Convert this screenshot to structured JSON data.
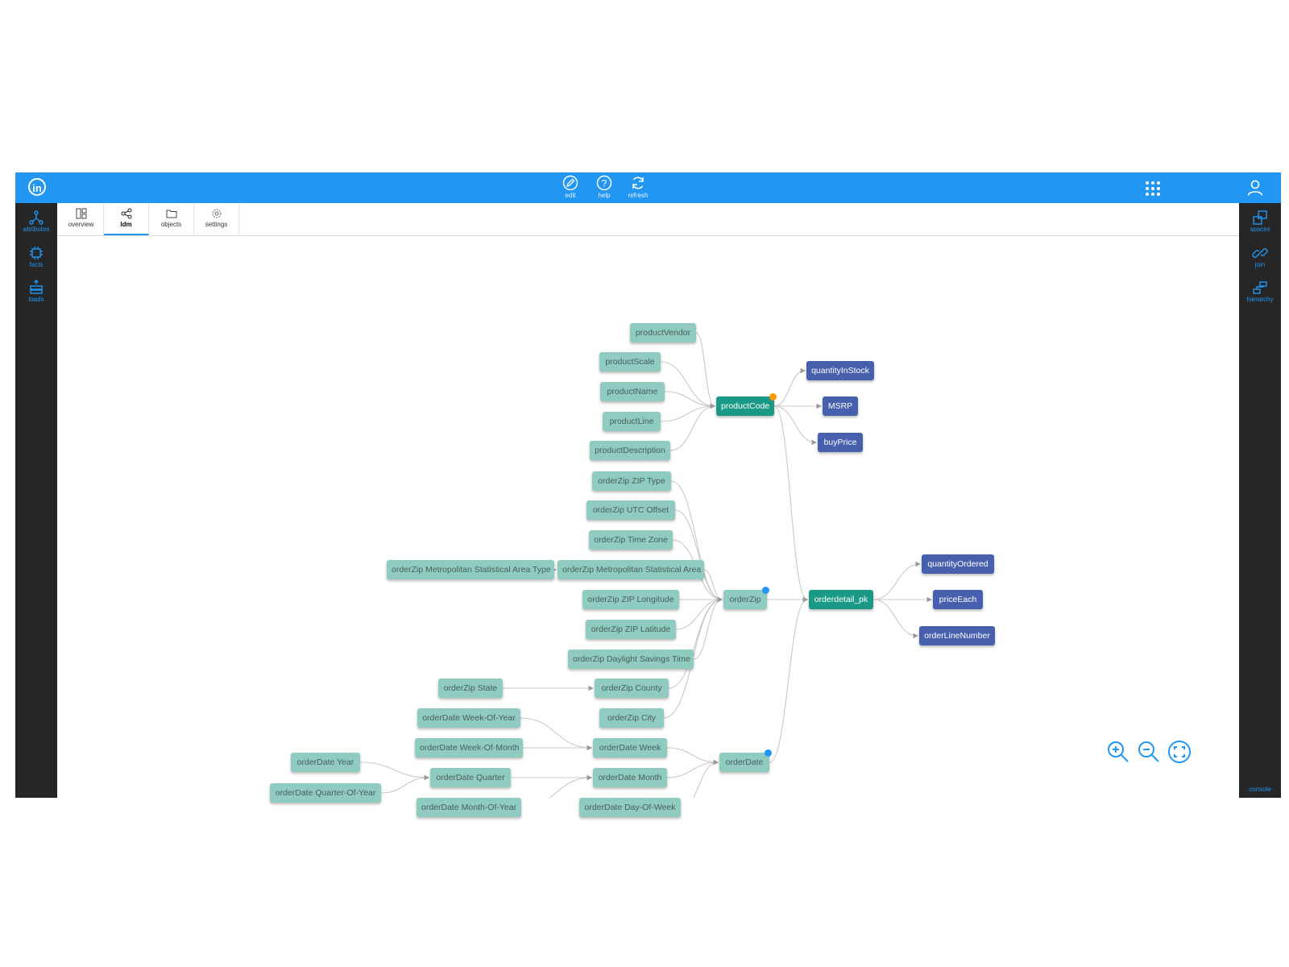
{
  "header": {
    "logo_text": "in",
    "tools": [
      {
        "label": "edit",
        "icon": "edit-icon"
      },
      {
        "label": "help",
        "icon": "help-icon"
      },
      {
        "label": "refresh",
        "icon": "refresh-icon"
      }
    ],
    "apps_icon": "apps-grid-icon",
    "user_icon": "user-icon"
  },
  "left_sidebar": {
    "items": [
      {
        "label": "attributes",
        "icon": "attributes-icon"
      },
      {
        "label": "facts",
        "icon": "facts-icon"
      },
      {
        "label": "loads",
        "icon": "loads-icon"
      }
    ]
  },
  "right_sidebar": {
    "items": [
      {
        "label": "spaces",
        "icon": "spaces-icon"
      },
      {
        "label": "join",
        "icon": "join-icon"
      },
      {
        "label": "hierarchy",
        "icon": "hierarchy-icon"
      }
    ],
    "console_label": "console"
  },
  "tabs": [
    {
      "label": "overview",
      "icon": "overview-icon"
    },
    {
      "label": "ldm",
      "icon": "ldm-icon",
      "active": true
    },
    {
      "label": "objects",
      "icon": "folder-icon"
    },
    {
      "label": "settings",
      "icon": "settings-icon"
    }
  ],
  "colors": {
    "topbar": "#2196f3",
    "sidebar": "#262626",
    "attribute_node": "#8fcbc0",
    "key_node": "#1a9a86",
    "fact_node": "#4760ad",
    "edge": "#c8c8c8",
    "dot_orange": "#ff9800",
    "dot_blue": "#2196f3"
  },
  "graph": {
    "nodes": [
      {
        "id": "productVendor",
        "label": "productVendor",
        "kind": "attr"
      },
      {
        "id": "productScale",
        "label": "productScale",
        "kind": "attr"
      },
      {
        "id": "productName",
        "label": "productName",
        "kind": "attr"
      },
      {
        "id": "productLine",
        "label": "productLine",
        "kind": "attr"
      },
      {
        "id": "productDescription",
        "label": "productDescription",
        "kind": "attr"
      },
      {
        "id": "productCode",
        "label": "productCode",
        "kind": "key",
        "badge": "orange"
      },
      {
        "id": "quantityInStock",
        "label": "quantityInStock",
        "kind": "fact"
      },
      {
        "id": "MSRP",
        "label": "MSRP",
        "kind": "fact"
      },
      {
        "id": "buyPrice",
        "label": "buyPrice",
        "kind": "fact"
      },
      {
        "id": "zipType",
        "label": "orderZip ZIP Type",
        "kind": "attr"
      },
      {
        "id": "zipUtc",
        "label": "orderZip UTC Offset",
        "kind": "attr"
      },
      {
        "id": "zipTz",
        "label": "orderZip Time Zone",
        "kind": "attr"
      },
      {
        "id": "zipMsaType",
        "label": "orderZip Metropolitan Statistical Area Type",
        "kind": "attr"
      },
      {
        "id": "zipMsa",
        "label": "orderZip Metropolitan Statistical Area",
        "kind": "attr"
      },
      {
        "id": "zipLon",
        "label": "orderZip ZIP Longitude",
        "kind": "attr"
      },
      {
        "id": "zipLat",
        "label": "orderZip ZIP Latitude",
        "kind": "attr"
      },
      {
        "id": "zipDst",
        "label": "orderZip Daylight Savings Time",
        "kind": "attr"
      },
      {
        "id": "zipState",
        "label": "orderZip State",
        "kind": "attr"
      },
      {
        "id": "zipCounty",
        "label": "orderZip County",
        "kind": "attr"
      },
      {
        "id": "zipCity",
        "label": "orderZip City",
        "kind": "attr"
      },
      {
        "id": "orderZip",
        "label": "orderZip",
        "kind": "attr",
        "badge": "blue"
      },
      {
        "id": "orderdetail_pk",
        "label": "orderdetail_pk",
        "kind": "key"
      },
      {
        "id": "quantityOrdered",
        "label": "quantityOrdered",
        "kind": "fact"
      },
      {
        "id": "priceEach",
        "label": "priceEach",
        "kind": "fact"
      },
      {
        "id": "orderLineNumber",
        "label": "orderLineNumber",
        "kind": "fact"
      },
      {
        "id": "dWoy",
        "label": "orderDate Week-Of-Year",
        "kind": "attr"
      },
      {
        "id": "dWom",
        "label": "orderDate Week-Of-Month",
        "kind": "attr"
      },
      {
        "id": "dYear",
        "label": "orderDate Year",
        "kind": "attr"
      },
      {
        "id": "dQoy",
        "label": "orderDate Quarter-Of-Year",
        "kind": "attr"
      },
      {
        "id": "dQuarter",
        "label": "orderDate Quarter",
        "kind": "attr"
      },
      {
        "id": "dMoy",
        "label": "orderDate Month-Of-Year",
        "kind": "attr"
      },
      {
        "id": "dWeek",
        "label": "orderDate Week",
        "kind": "attr"
      },
      {
        "id": "dMonth",
        "label": "orderDate Month",
        "kind": "attr"
      },
      {
        "id": "dDow",
        "label": "orderDate Day-Of-Week",
        "kind": "attr"
      },
      {
        "id": "orderDate",
        "label": "orderDate",
        "kind": "attr",
        "badge": "blue"
      }
    ],
    "edges": [
      [
        "productVendor",
        "productCode"
      ],
      [
        "productScale",
        "productCode"
      ],
      [
        "productName",
        "productCode"
      ],
      [
        "productLine",
        "productCode"
      ],
      [
        "productDescription",
        "productCode"
      ],
      [
        "productCode",
        "quantityInStock"
      ],
      [
        "productCode",
        "MSRP"
      ],
      [
        "productCode",
        "buyPrice"
      ],
      [
        "productCode",
        "orderdetail_pk"
      ],
      [
        "zipType",
        "orderZip"
      ],
      [
        "zipUtc",
        "orderZip"
      ],
      [
        "zipTz",
        "orderZip"
      ],
      [
        "zipMsa",
        "orderZip"
      ],
      [
        "zipMsaType",
        "zipMsa"
      ],
      [
        "zipLon",
        "orderZip"
      ],
      [
        "zipLat",
        "orderZip"
      ],
      [
        "zipDst",
        "orderZip"
      ],
      [
        "zipCounty",
        "orderZip"
      ],
      [
        "zipCity",
        "orderZip"
      ],
      [
        "zipState",
        "zipCounty"
      ],
      [
        "orderZip",
        "orderdetail_pk"
      ],
      [
        "orderdetail_pk",
        "quantityOrdered"
      ],
      [
        "orderdetail_pk",
        "priceEach"
      ],
      [
        "orderdetail_pk",
        "orderLineNumber"
      ],
      [
        "dWoy",
        "dWeek"
      ],
      [
        "dWom",
        "dWeek"
      ],
      [
        "dYear",
        "dQuarter"
      ],
      [
        "dQoy",
        "dQuarter"
      ],
      [
        "dQuarter",
        "dMonth"
      ],
      [
        "dMoy",
        "dMonth"
      ],
      [
        "dWeek",
        "orderDate"
      ],
      [
        "dMonth",
        "orderDate"
      ],
      [
        "dDow",
        "orderDate"
      ],
      [
        "orderDate",
        "orderdetail_pk"
      ]
    ]
  },
  "zoom_controls": [
    {
      "icon": "zoom-in-icon"
    },
    {
      "icon": "zoom-out-icon"
    },
    {
      "icon": "fit-screen-icon"
    }
  ]
}
